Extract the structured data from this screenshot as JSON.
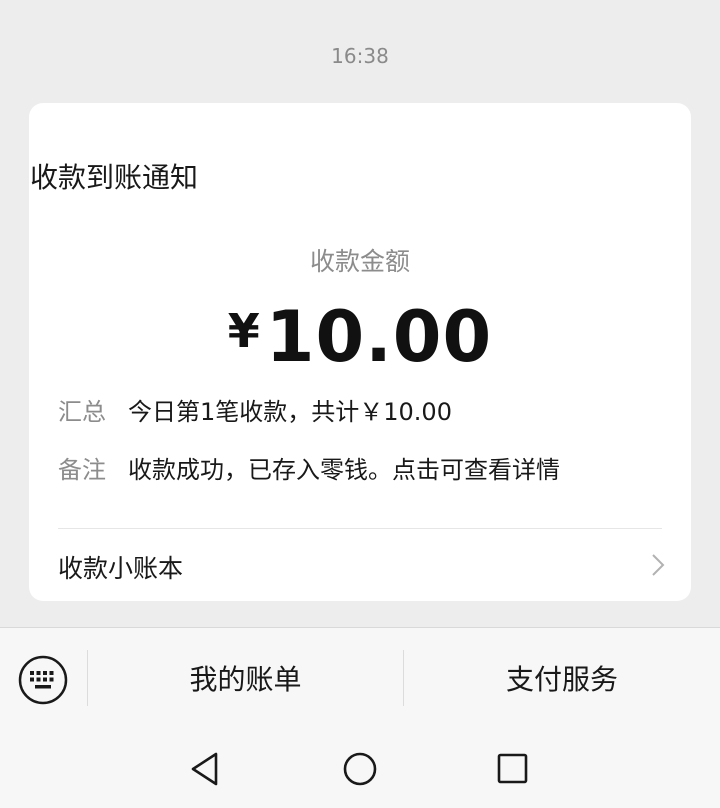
{
  "message": {
    "timestamp": "16:38"
  },
  "card": {
    "title": "收款到账通知",
    "amount_label": "收款金额",
    "currency_symbol": "¥",
    "amount": "10.00",
    "summary": {
      "key": "汇总",
      "value": "今日第1笔收款，共计￥10.00"
    },
    "note": {
      "key": "备注",
      "value": "收款成功，已存入零钱。点击可查看详情"
    },
    "ledger_link": {
      "label": "收款小账本",
      "icon": "chevron-right-icon"
    }
  },
  "bottom_menu": {
    "keyboard_icon": "keyboard-icon",
    "items": [
      {
        "label": "我的账单"
      },
      {
        "label": "支付服务"
      }
    ]
  },
  "system_nav": {
    "back_icon": "back-triangle-icon",
    "home_icon": "home-circle-icon",
    "recents_icon": "recents-square-icon"
  },
  "colors": {
    "background": "#ededed",
    "card": "#ffffff",
    "primary_text": "#191919",
    "secondary_text": "#8c8c8c"
  }
}
